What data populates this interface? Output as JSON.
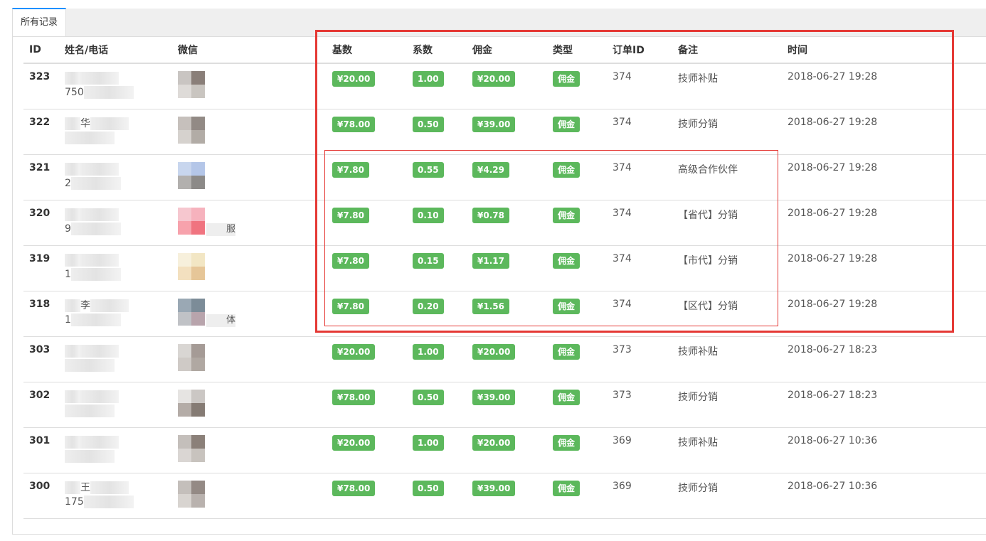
{
  "tabs": [
    {
      "label": "所有记录",
      "active": true
    }
  ],
  "table": {
    "headers": [
      "ID",
      "姓名/电话",
      "微信",
      "基数",
      "系数",
      "佣金",
      "类型",
      "订单ID",
      "备注",
      "时间"
    ],
    "rows": [
      {
        "id": "323",
        "name": "",
        "phone": "750",
        "wechat": "",
        "base": "¥20.00",
        "coef": "1.00",
        "commission": "¥20.00",
        "type": "佣金",
        "order_id": "374",
        "note": "技师补贴",
        "time": "2018-06-27 19:28",
        "avatar": [
          "#c9c5c2",
          "#8a7f79",
          "#dedbd8",
          "#c9c5c0"
        ]
      },
      {
        "id": "322",
        "name": "华",
        "phone": "",
        "wechat": "",
        "base": "¥78.00",
        "coef": "0.50",
        "commission": "¥39.00",
        "type": "佣金",
        "order_id": "374",
        "note": "技师分销",
        "time": "2018-06-27 19:28",
        "avatar": [
          "#c6c0bc",
          "#928a85",
          "#d6d2ce",
          "#b2aca6"
        ]
      },
      {
        "id": "321",
        "name": "",
        "phone": "2",
        "wechat": "",
        "base": "¥7.80",
        "coef": "0.55",
        "commission": "¥4.29",
        "type": "佣金",
        "order_id": "374",
        "note": "高级合作伙伴",
        "time": "2018-06-27 19:28",
        "avatar": [
          "#c8d6ee",
          "#b4c6e8",
          "#b2b0ae",
          "#8c8a88"
        ]
      },
      {
        "id": "320",
        "name": "",
        "phone": "9",
        "wechat": "服",
        "base": "¥7.80",
        "coef": "0.10",
        "commission": "¥0.78",
        "type": "佣金",
        "order_id": "374",
        "note": "【省代】分销",
        "time": "2018-06-27 19:28",
        "avatar": [
          "#f6c7cf",
          "#f6b2bd",
          "#f7a2ac",
          "#f07480"
        ]
      },
      {
        "id": "319",
        "name": "",
        "phone": "1",
        "wechat": "",
        "base": "¥7.80",
        "coef": "0.15",
        "commission": "¥1.17",
        "type": "佣金",
        "order_id": "374",
        "note": "【市代】分销",
        "time": "2018-06-27 19:28",
        "avatar": [
          "#f7f0dc",
          "#f2e6c4",
          "#f3e0bf",
          "#e6c698"
        ]
      },
      {
        "id": "318",
        "name": "李",
        "phone": "1",
        "wechat": "体",
        "base": "¥7.80",
        "coef": "0.20",
        "commission": "¥1.56",
        "type": "佣金",
        "order_id": "374",
        "note": "【区代】分销",
        "time": "2018-06-27 19:28",
        "avatar": [
          "#9aa8b4",
          "#7c8c98",
          "#c0c2c6",
          "#b8a4ac"
        ]
      },
      {
        "id": "303",
        "name": "",
        "phone": "",
        "wechat": "",
        "base": "¥20.00",
        "coef": "1.00",
        "commission": "¥20.00",
        "type": "佣金",
        "order_id": "373",
        "note": "技师补贴",
        "time": "2018-06-27 18:23",
        "avatar": [
          "#d9d6d3",
          "#a59b96",
          "#cfcac6",
          "#b0a8a2"
        ]
      },
      {
        "id": "302",
        "name": "",
        "phone": "",
        "wechat": "",
        "base": "¥78.00",
        "coef": "0.50",
        "commission": "¥39.00",
        "type": "佣金",
        "order_id": "373",
        "note": "技师分销",
        "time": "2018-06-27 18:23",
        "avatar": [
          "#e6e4e2",
          "#cbc7c4",
          "#b4aca7",
          "#857b74"
        ]
      },
      {
        "id": "301",
        "name": "",
        "phone": "",
        "wechat": "",
        "base": "¥20.00",
        "coef": "1.00",
        "commission": "¥20.00",
        "type": "佣金",
        "order_id": "369",
        "note": "技师补贴",
        "time": "2018-06-27 10:36",
        "avatar": [
          "#c4bfbb",
          "#8b8079",
          "#dad6d3",
          "#c8c3be"
        ]
      },
      {
        "id": "300",
        "name": "王",
        "phone": "175",
        "wechat": "",
        "base": "¥78.00",
        "coef": "0.50",
        "commission": "¥39.00",
        "type": "佣金",
        "order_id": "369",
        "note": "技师分销",
        "time": "2018-06-27 10:36",
        "avatar": [
          "#c4bfbb",
          "#948a85",
          "#d8d4d0",
          "#b9b2ae"
        ]
      }
    ]
  },
  "colors": {
    "badge": "#5cb85c",
    "highlight": "#e53935",
    "tab_accent": "#1e90ff"
  }
}
